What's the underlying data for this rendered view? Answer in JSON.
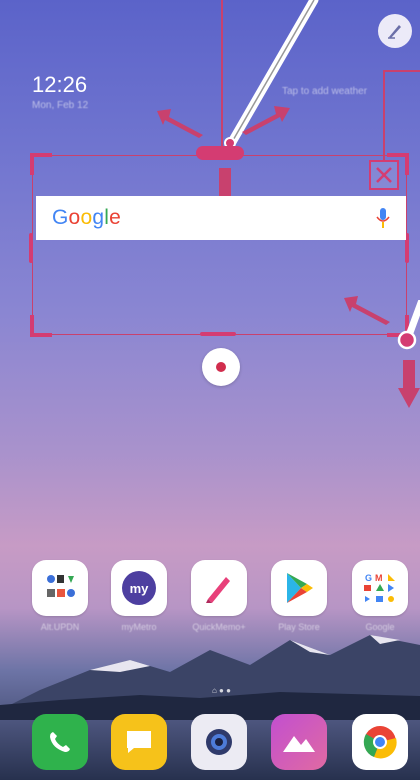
{
  "status": {
    "time": "12:26",
    "date": "Mon, Feb 12",
    "weather_prompt": "Tap to add weather"
  },
  "search_widget": {
    "logo_text": "Google"
  },
  "apps": [
    {
      "label": "Alt.UPDN",
      "icon": "folder-icon"
    },
    {
      "label": "myMetro",
      "icon": "my-icon"
    },
    {
      "label": "QuickMemo+",
      "icon": "pencil-icon"
    },
    {
      "label": "Play Store",
      "icon": "play-store-icon"
    },
    {
      "label": "Google",
      "icon": "google-folder-icon"
    }
  ],
  "dock": [
    {
      "icon": "phone-icon"
    },
    {
      "icon": "messages-icon"
    },
    {
      "icon": "camera-icon"
    },
    {
      "icon": "gallery-icon"
    },
    {
      "icon": "chrome-icon"
    }
  ],
  "colors": {
    "accent": "#d43c72",
    "record": "#d12d4d",
    "google_mic": "#4285f4"
  }
}
